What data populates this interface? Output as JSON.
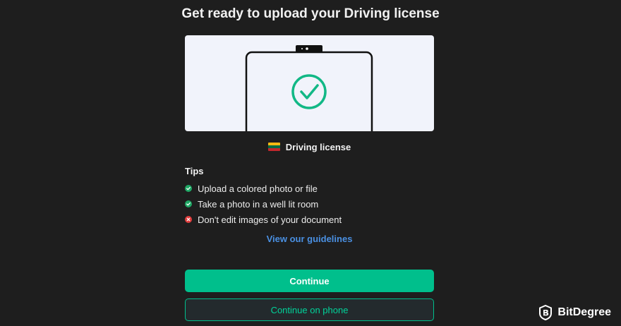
{
  "page": {
    "title": "Get ready to upload your Driving license"
  },
  "document": {
    "label": "Driving license",
    "flag_colors": [
      "#fdb913",
      "#006a44",
      "#c1272d"
    ]
  },
  "tips": {
    "heading": "Tips",
    "items": [
      {
        "text": "Upload a colored photo or file",
        "status": "ok"
      },
      {
        "text": "Take a photo in a well lit room",
        "status": "ok"
      },
      {
        "text": "Don't edit images of your document",
        "status": "bad"
      }
    ]
  },
  "links": {
    "guidelines": "View our guidelines"
  },
  "buttons": {
    "continue": "Continue",
    "continue_phone": "Continue on phone"
  },
  "watermark": {
    "text": "BitDegree"
  },
  "colors": {
    "accent": "#00bf8c",
    "link": "#4a90e2",
    "success": "#1fa865",
    "error": "#e03c3c",
    "background": "#1e1e1e"
  },
  "icons": {
    "illustration_check": "check-circle-icon",
    "tip_ok": "check-circle-icon",
    "tip_bad": "x-circle-icon",
    "brand": "bitdegree-logo-icon"
  }
}
